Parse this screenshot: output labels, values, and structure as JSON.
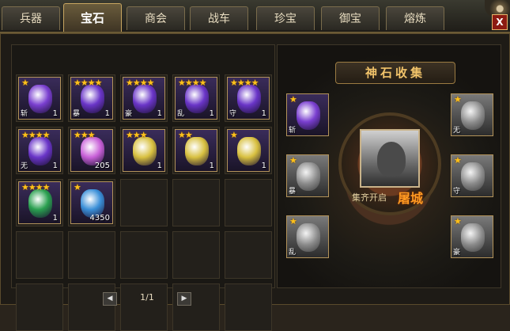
{
  "tabs": [
    {
      "label": "兵器",
      "active": false
    },
    {
      "label": "宝石",
      "active": true
    },
    {
      "label": "商会",
      "active": false
    },
    {
      "label": "战车",
      "active": false
    },
    {
      "label": "珍宝",
      "active": false
    },
    {
      "label": "御宝",
      "active": false
    },
    {
      "label": "熔炼",
      "active": false
    }
  ],
  "close_label": "X",
  "inventory": [
    {
      "stars": "★",
      "count": "1",
      "caption": "斩",
      "color": "#7a3fd0"
    },
    {
      "stars": "★★★★",
      "count": "1",
      "caption": "暴",
      "color": "#6a35c8"
    },
    {
      "stars": "★★★★",
      "count": "1",
      "caption": "豪",
      "color": "#6a35c8"
    },
    {
      "stars": "★★★★",
      "count": "1",
      "caption": "乱",
      "color": "#6a35c8"
    },
    {
      "stars": "★★★★",
      "count": "1",
      "caption": "守",
      "color": "#6a35c8"
    },
    {
      "stars": "★★★★",
      "count": "1",
      "caption": "无",
      "color": "#6a35c8"
    },
    {
      "stars": "★★★",
      "count": "205",
      "caption": "",
      "color": "#c860d8"
    },
    {
      "stars": "★★★",
      "count": "1",
      "caption": "",
      "color": "#d8c040"
    },
    {
      "stars": "★★",
      "count": "1",
      "caption": "",
      "color": "#d8c040"
    },
    {
      "stars": "★",
      "count": "1",
      "caption": "",
      "color": "#d8c040"
    },
    {
      "stars": "★★★★",
      "count": "1",
      "caption": "",
      "color": "#2aa050"
    },
    {
      "stars": "★",
      "count": "4350",
      "caption": "",
      "color": "#3a8fd8"
    }
  ],
  "pager": {
    "text": "1/1",
    "prev": "◀",
    "next": "▶"
  },
  "collection": {
    "title": "神石收集",
    "unlock_text": "集齐开启",
    "unlock_target": "屠城",
    "slots": [
      {
        "stars": "★",
        "caption": "斩",
        "color": "#7a3fd0",
        "collected": true
      },
      {
        "stars": "★",
        "caption": "暴",
        "collected": false
      },
      {
        "stars": "★",
        "caption": "乱",
        "collected": false
      },
      {
        "stars": "★",
        "caption": "无",
        "collected": false
      },
      {
        "stars": "★",
        "caption": "守",
        "collected": false
      },
      {
        "stars": "★",
        "caption": "豪",
        "collected": false
      }
    ]
  }
}
